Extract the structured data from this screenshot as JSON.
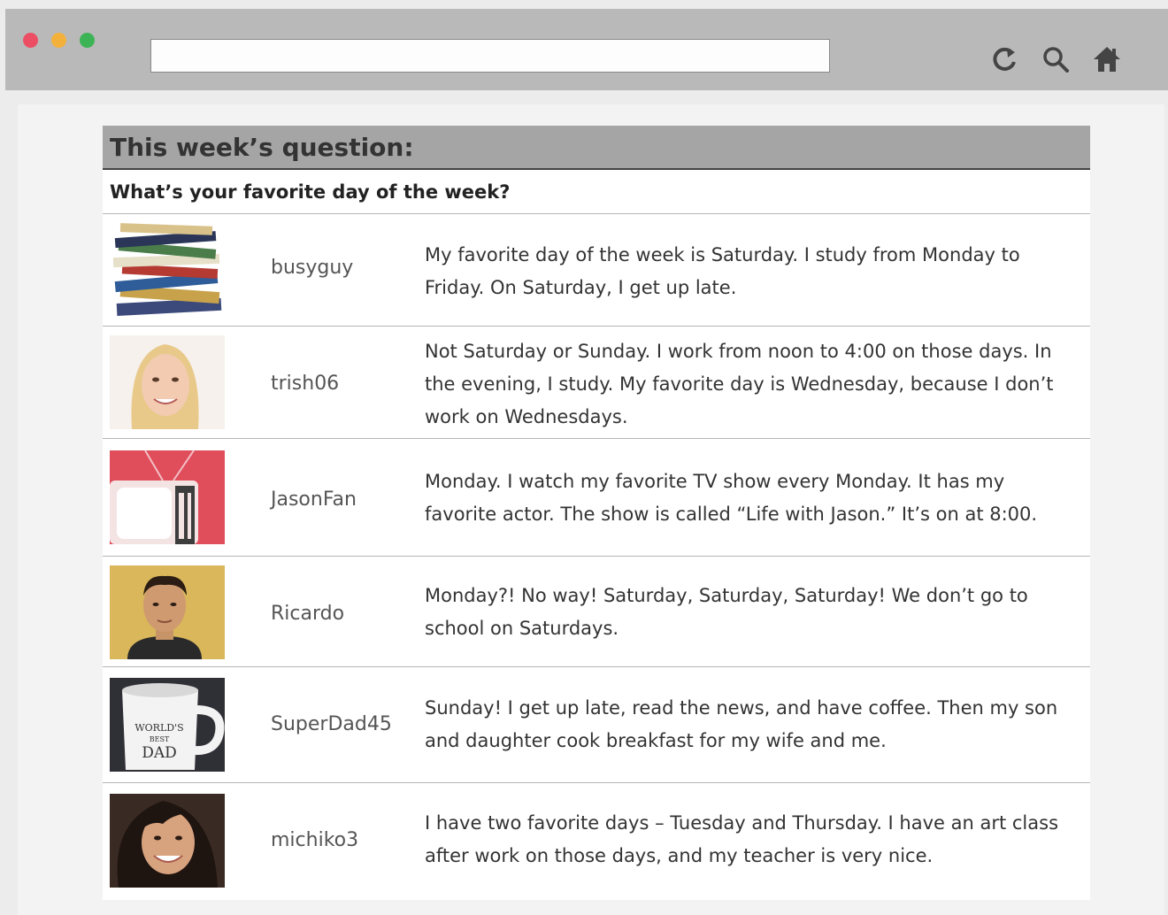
{
  "browser": {
    "url_value": "",
    "icons": [
      "reload-icon",
      "search-icon",
      "home-icon"
    ]
  },
  "forum": {
    "header": "This week’s question:",
    "question": "What’s your favorite day of the week?",
    "posts": [
      {
        "avatar": "books-stack-image",
        "username": "busyguy",
        "text": "My favorite day of the week is Saturday. I study from Monday to Friday. On Saturday, I get up late."
      },
      {
        "avatar": "woman-smiling-image",
        "username": "trish06",
        "text": "Not Saturday or Sunday. I work from noon to 4:00 on those days. In the evening, I study. My favorite day is Wednesday, because I don’t work on Wednesdays."
      },
      {
        "avatar": "retro-tv-image",
        "username": "JasonFan",
        "text": "Monday. I watch my favorite TV show every Monday. It has my favorite actor. The show is called “Life with Jason.” It’s on at 8:00."
      },
      {
        "avatar": "young-man-image",
        "username": "Ricardo",
        "text": "Monday?! No way! Saturday, Saturday, Saturday! We don’t go to school on Saturdays."
      },
      {
        "avatar": "worlds-best-dad-mug-image",
        "username": "SuperDad45",
        "text": "Sunday! I get up late, read the news, and have coffee. Then my son and daughter cook breakfast for my wife and me.",
        "mug_text": [
          "WORLD'S",
          "BEST",
          "DAD"
        ]
      },
      {
        "avatar": "smiling-woman-image",
        "username": "michiko3",
        "text": "I have two favorite days – Tuesday and Thursday. I have an art class after work on those days, and my teacher is very nice."
      }
    ]
  }
}
